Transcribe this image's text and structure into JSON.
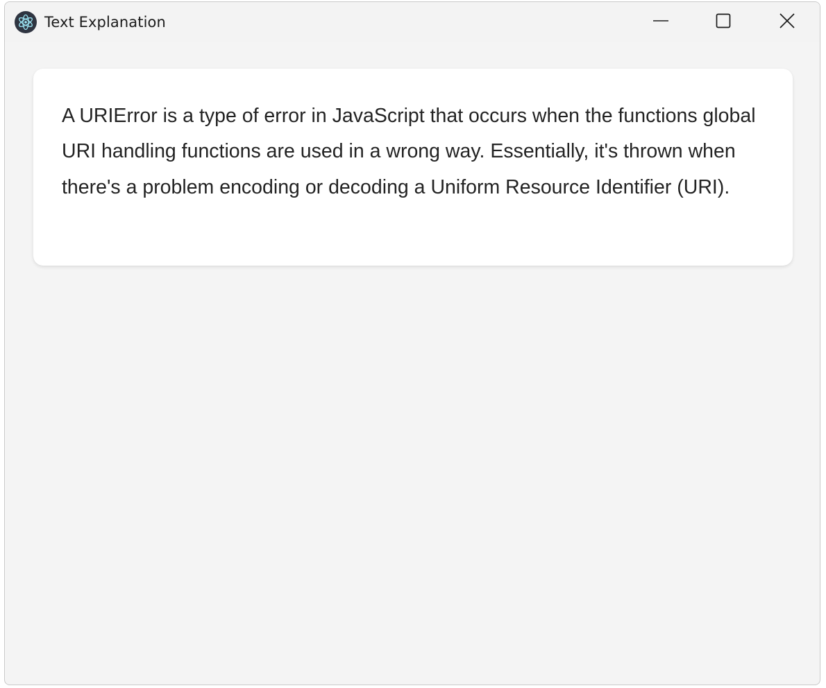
{
  "window": {
    "title": "Text Explanation",
    "app_icon": "electron-atom-icon",
    "controls": {
      "minimize": "minimize-icon",
      "maximize": "maximize-icon",
      "close": "close-icon"
    }
  },
  "content": {
    "explanation": "A URIError is a type of error in JavaScript that occurs when the functions global URI handling functions are used in a wrong way. Essentially, it's thrown when there's a problem encoding or decoding a Uniform Resource Identifier (URI)."
  },
  "colors": {
    "window_background": "#f4f4f4",
    "card_background": "#ffffff",
    "text": "#232323",
    "app_icon_background": "#2f3541"
  }
}
